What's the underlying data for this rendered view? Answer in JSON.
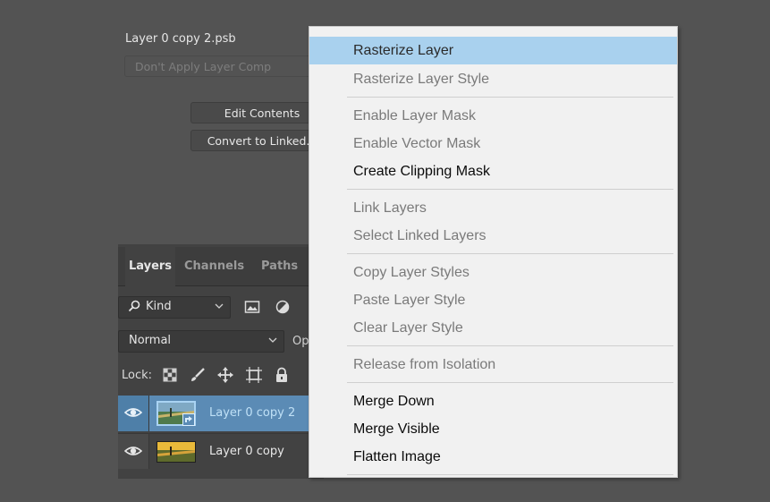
{
  "properties": {
    "document_name": "Layer 0 copy 2.psb",
    "layer_comp_placeholder": "Don't Apply Layer Comp",
    "edit_contents_label": "Edit Contents",
    "convert_label": "Convert to Linked..."
  },
  "layers_panel": {
    "tabs": [
      {
        "label": "Layers",
        "active": true
      },
      {
        "label": "Channels",
        "active": false
      },
      {
        "label": "Paths",
        "active": false
      }
    ],
    "kind_filter": "Kind",
    "blend_mode": "Normal",
    "opacity_label": "Op",
    "lock_label": "Lock:",
    "layers": [
      {
        "name": "Layer 0 copy 2",
        "selected": true,
        "visible": true
      },
      {
        "name": "Layer 0 copy",
        "selected": false,
        "visible": true
      }
    ]
  },
  "context_menu": {
    "items": [
      {
        "label": "Rasterize Layer",
        "state": "highlighted"
      },
      {
        "label": "Rasterize Layer Style",
        "state": "disabled"
      },
      {
        "label": "Enable Layer Mask",
        "state": "disabled"
      },
      {
        "label": "Enable Vector Mask",
        "state": "disabled"
      },
      {
        "label": "Create Clipping Mask",
        "state": "enabled"
      },
      {
        "label": "Link Layers",
        "state": "disabled"
      },
      {
        "label": "Select Linked Layers",
        "state": "disabled"
      },
      {
        "label": "Copy Layer Styles",
        "state": "disabled"
      },
      {
        "label": "Paste Layer Style",
        "state": "disabled"
      },
      {
        "label": "Clear Layer Style",
        "state": "disabled"
      },
      {
        "label": "Release from Isolation",
        "state": "disabled"
      },
      {
        "label": "Merge Down",
        "state": "enabled"
      },
      {
        "label": "Merge Visible",
        "state": "enabled"
      },
      {
        "label": "Flatten Image",
        "state": "enabled"
      }
    ]
  },
  "colors": {
    "app_background": "#535353",
    "menu_highlight": "#a9d1ee",
    "selected_layer": "#5b8bb5"
  },
  "icons": [
    "search-icon",
    "image-filter-icon",
    "adjustment-filter-icon",
    "chevron-down-icon",
    "lock-transparent-icon",
    "lock-brush-icon",
    "lock-move-icon",
    "lock-artboard-icon",
    "lock-all-icon",
    "eye-icon",
    "smart-object-badge-icon"
  ]
}
